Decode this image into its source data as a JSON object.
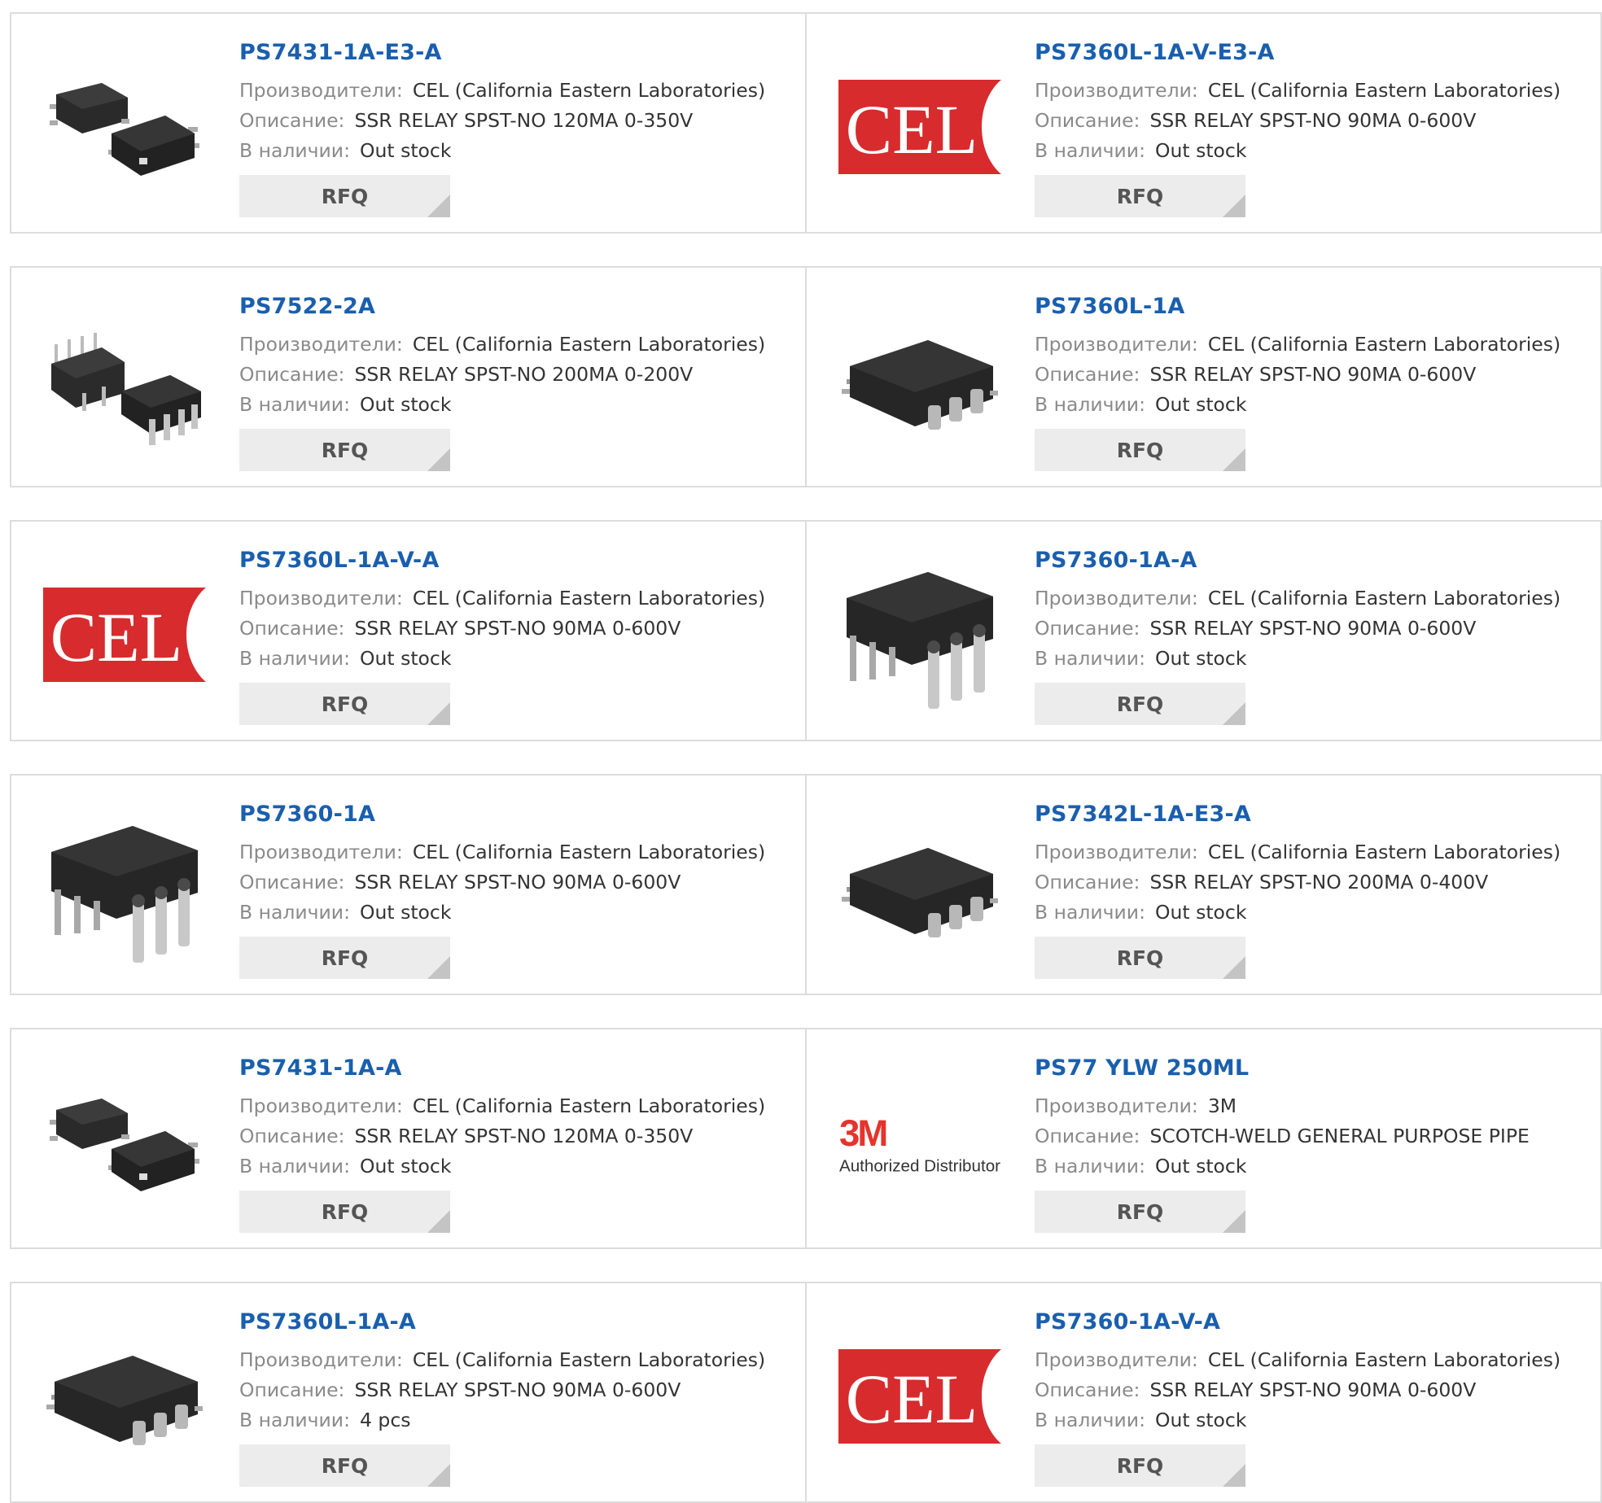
{
  "labels": {
    "manufacturer": "Производители:",
    "description": "Описание:",
    "stock": "В наличии:",
    "rfq": "RFQ"
  },
  "logos": {
    "cel_text": "CEL",
    "m3_text": "3M",
    "m3_sub": "Authorized Distributor"
  },
  "colors": {
    "link": "#1a5fae",
    "cel_red": "#d72b2e",
    "m3_red": "#e5342c"
  },
  "products": [
    {
      "part": "PS7431-1A-E3-A",
      "image": "smd-4pin-pair-icon",
      "manufacturer": "CEL (California Eastern Laboratories)",
      "description": "SSR RELAY SPST-NO 120MA 0-350V",
      "stock": "Out stock"
    },
    {
      "part": "PS7360L-1A-V-E3-A",
      "image": "cel-logo",
      "manufacturer": "CEL (California Eastern Laboratories)",
      "description": "SSR RELAY SPST-NO 90MA 0-600V",
      "stock": "Out stock"
    },
    {
      "part": "PS7522-2A",
      "image": "dip-pair-icon",
      "manufacturer": "CEL (California Eastern Laboratories)",
      "description": "SSR RELAY SPST-NO 200MA 0-200V",
      "stock": "Out stock"
    },
    {
      "part": "PS7360L-1A",
      "image": "smd-6pin-icon",
      "manufacturer": "CEL (California Eastern Laboratories)",
      "description": "SSR RELAY SPST-NO 90MA 0-600V",
      "stock": "Out stock"
    },
    {
      "part": "PS7360L-1A-V-A",
      "image": "cel-logo",
      "manufacturer": "CEL (California Eastern Laboratories)",
      "description": "SSR RELAY SPST-NO 90MA 0-600V",
      "stock": "Out stock"
    },
    {
      "part": "PS7360-1A-A",
      "image": "dip-6pin-icon",
      "manufacturer": "CEL (California Eastern Laboratories)",
      "description": "SSR RELAY SPST-NO 90MA 0-600V",
      "stock": "Out stock"
    },
    {
      "part": "PS7360-1A",
      "image": "dip-6pin-icon",
      "manufacturer": "CEL (California Eastern Laboratories)",
      "description": "SSR RELAY SPST-NO 90MA 0-600V",
      "stock": "Out stock"
    },
    {
      "part": "PS7342L-1A-E3-A",
      "image": "smd-6pin-icon",
      "manufacturer": "CEL (California Eastern Laboratories)",
      "description": "SSR RELAY SPST-NO 200MA 0-400V",
      "stock": "Out stock"
    },
    {
      "part": "PS7431-1A-A",
      "image": "smd-4pin-pair-icon",
      "manufacturer": "CEL (California Eastern Laboratories)",
      "description": "SSR RELAY SPST-NO 120MA 0-350V",
      "stock": "Out stock"
    },
    {
      "part": "PS77 YLW 250ML",
      "image": "3m-logo",
      "manufacturer": "3M",
      "description": "SCOTCH-WELD GENERAL PURPOSE PIPE",
      "stock": "Out stock"
    },
    {
      "part": "PS7360L-1A-A",
      "image": "smd-6pin-icon",
      "manufacturer": "CEL (California Eastern Laboratories)",
      "description": "SSR RELAY SPST-NO 90MA 0-600V",
      "stock": "4 pcs"
    },
    {
      "part": "PS7360-1A-V-A",
      "image": "cel-logo",
      "manufacturer": "CEL (California Eastern Laboratories)",
      "description": "SSR RELAY SPST-NO 90MA 0-600V",
      "stock": "Out stock"
    }
  ]
}
